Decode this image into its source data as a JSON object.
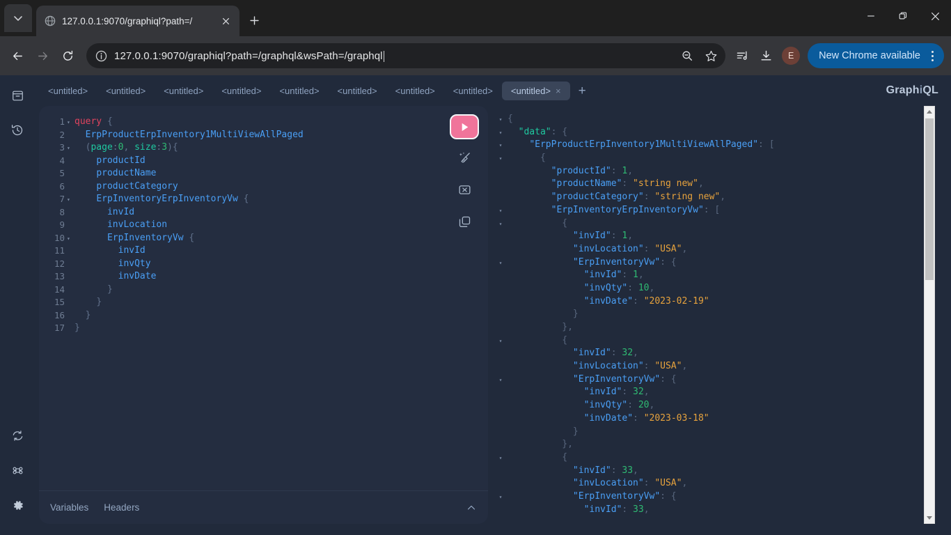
{
  "browser": {
    "tab": {
      "title": "127.0.0.1:9070/graphiql?path=/",
      "favicon_icon": "globe-icon",
      "close_icon": "close-icon"
    },
    "tab_search_icon": "chevron-down-icon",
    "new_tab_icon": "plus-icon",
    "window_controls": {
      "minimize": "minimize-icon",
      "maximize": "restore-icon",
      "close": "close-icon"
    },
    "nav": {
      "back_icon": "arrow-left-icon",
      "forward_icon": "arrow-right-icon",
      "reload_icon": "reload-icon"
    },
    "omnibox": {
      "url": "127.0.0.1:9070/graphiql?path=/graphql&wsPath=/graphql",
      "info_icon": "info-circle-icon",
      "zoom_icon": "search-minus-icon",
      "bookmark_icon": "star-icon"
    },
    "toolbar": {
      "media_icon": "media-playlist-icon",
      "downloads_icon": "download-icon",
      "profile_initial": "E",
      "update_label": "New Chrome available",
      "menu_icon": "kebab-menu-icon",
      "accent_color": "#0a5b9c"
    }
  },
  "graphiql": {
    "logo": {
      "prefix": "Graph",
      "middle": "i",
      "suffix": "QL"
    },
    "sidebar": [
      {
        "name": "docs-icon",
        "title": "Show Documentation Explorer"
      },
      {
        "name": "history-icon",
        "title": "Show History"
      },
      {
        "name": "refetch-icon",
        "title": "Re-fetch GraphQL schema"
      },
      {
        "name": "shortcuts-icon",
        "title": "Open short keys dialog"
      },
      {
        "name": "settings-icon",
        "title": "Open settings dialog"
      }
    ],
    "tabs": [
      {
        "label": "<untitled>",
        "active": false
      },
      {
        "label": "<untitled>",
        "active": false
      },
      {
        "label": "<untitled>",
        "active": false
      },
      {
        "label": "<untitled>",
        "active": false
      },
      {
        "label": "<untitled>",
        "active": false
      },
      {
        "label": "<untitled>",
        "active": false
      },
      {
        "label": "<untitled>",
        "active": false
      },
      {
        "label": "<untitled>",
        "active": false
      },
      {
        "label": "<untitled>",
        "active": true
      }
    ],
    "add_tab_label": "+",
    "close_tab_label": "×",
    "editor_tools": {
      "execute_icon": "play-icon",
      "execute_color": "#f0749a",
      "prettify_icon": "prettify-broom-icon",
      "merge_icon": "merge-icon",
      "copy_icon": "copy-icon"
    },
    "editor_footer": {
      "variables_label": "Variables",
      "headers_label": "Headers",
      "collapse_icon": "chevron-up-icon"
    },
    "query_lines": [
      {
        "n": "1",
        "fold": "▾",
        "tokens": [
          [
            "kw",
            "query"
          ],
          [
            "plain",
            " "
          ],
          [
            "punc",
            "{"
          ]
        ]
      },
      {
        "n": "2",
        "fold": "",
        "tokens": [
          [
            "plain",
            "  "
          ],
          [
            "field",
            "ErpProductErpInventory1MultiViewAllPaged"
          ]
        ]
      },
      {
        "n": "3",
        "fold": "▾",
        "tokens": [
          [
            "plain",
            "  "
          ],
          [
            "punc",
            "("
          ],
          [
            "arg",
            "page"
          ],
          [
            "punc",
            ":"
          ],
          [
            "num",
            "0"
          ],
          [
            "punc",
            ", "
          ],
          [
            "arg",
            "size"
          ],
          [
            "punc",
            ":"
          ],
          [
            "num",
            "3"
          ],
          [
            "punc",
            "){"
          ]
        ]
      },
      {
        "n": "4",
        "fold": "",
        "tokens": [
          [
            "plain",
            "    "
          ],
          [
            "field",
            "productId"
          ]
        ]
      },
      {
        "n": "5",
        "fold": "",
        "tokens": [
          [
            "plain",
            "    "
          ],
          [
            "field",
            "productName"
          ]
        ]
      },
      {
        "n": "6",
        "fold": "",
        "tokens": [
          [
            "plain",
            "    "
          ],
          [
            "field",
            "productCategory"
          ]
        ]
      },
      {
        "n": "7",
        "fold": "▾",
        "tokens": [
          [
            "plain",
            "    "
          ],
          [
            "field",
            "ErpInventoryErpInventoryVw"
          ],
          [
            "plain",
            " "
          ],
          [
            "punc",
            "{"
          ]
        ]
      },
      {
        "n": "8",
        "fold": "",
        "tokens": [
          [
            "plain",
            "      "
          ],
          [
            "field",
            "invId"
          ]
        ]
      },
      {
        "n": "9",
        "fold": "",
        "tokens": [
          [
            "plain",
            "      "
          ],
          [
            "field",
            "invLocation"
          ]
        ]
      },
      {
        "n": "10",
        "fold": "▾",
        "tokens": [
          [
            "plain",
            "      "
          ],
          [
            "field",
            "ErpInventoryVw"
          ],
          [
            "plain",
            " "
          ],
          [
            "punc",
            "{"
          ]
        ]
      },
      {
        "n": "11",
        "fold": "",
        "tokens": [
          [
            "plain",
            "        "
          ],
          [
            "field",
            "invId"
          ]
        ]
      },
      {
        "n": "12",
        "fold": "",
        "tokens": [
          [
            "plain",
            "        "
          ],
          [
            "field",
            "invQty"
          ]
        ]
      },
      {
        "n": "13",
        "fold": "",
        "tokens": [
          [
            "plain",
            "        "
          ],
          [
            "field",
            "invDate"
          ]
        ]
      },
      {
        "n": "14",
        "fold": "",
        "tokens": [
          [
            "plain",
            "      "
          ],
          [
            "punc",
            "}"
          ]
        ]
      },
      {
        "n": "15",
        "fold": "",
        "tokens": [
          [
            "plain",
            "    "
          ],
          [
            "punc",
            "}"
          ]
        ]
      },
      {
        "n": "16",
        "fold": "",
        "tokens": [
          [
            "plain",
            "  "
          ],
          [
            "punc",
            "}"
          ]
        ]
      },
      {
        "n": "17",
        "fold": "",
        "tokens": [
          [
            "plain",
            ""
          ],
          [
            "punc",
            "}"
          ]
        ]
      }
    ],
    "response_lines": [
      {
        "fold": "▾",
        "tokens": [
          [
            "punc",
            "{"
          ]
        ]
      },
      {
        "fold": "▾",
        "tokens": [
          [
            "plain",
            "  "
          ],
          [
            "keytop",
            "\"data\""
          ],
          [
            "punc",
            ": {"
          ]
        ]
      },
      {
        "fold": "▾",
        "tokens": [
          [
            "plain",
            "    "
          ],
          [
            "key",
            "\"ErpProductErpInventory1MultiViewAllPaged\""
          ],
          [
            "punc",
            ": ["
          ]
        ]
      },
      {
        "fold": "▾",
        "tokens": [
          [
            "plain",
            "      "
          ],
          [
            "punc",
            "{"
          ]
        ]
      },
      {
        "fold": "",
        "tokens": [
          [
            "plain",
            "        "
          ],
          [
            "key",
            "\"productId\""
          ],
          [
            "punc",
            ": "
          ],
          [
            "num",
            "1"
          ],
          [
            "punc",
            ","
          ]
        ]
      },
      {
        "fold": "",
        "tokens": [
          [
            "plain",
            "        "
          ],
          [
            "key",
            "\"productName\""
          ],
          [
            "punc",
            ": "
          ],
          [
            "str",
            "\"string new\""
          ],
          [
            "punc",
            ","
          ]
        ]
      },
      {
        "fold": "",
        "tokens": [
          [
            "plain",
            "        "
          ],
          [
            "key",
            "\"productCategory\""
          ],
          [
            "punc",
            ": "
          ],
          [
            "str",
            "\"string new\""
          ],
          [
            "punc",
            ","
          ]
        ]
      },
      {
        "fold": "▾",
        "tokens": [
          [
            "plain",
            "        "
          ],
          [
            "key",
            "\"ErpInventoryErpInventoryVw\""
          ],
          [
            "punc",
            ": ["
          ]
        ]
      },
      {
        "fold": "▾",
        "tokens": [
          [
            "plain",
            "          "
          ],
          [
            "punc",
            "{"
          ]
        ]
      },
      {
        "fold": "",
        "tokens": [
          [
            "plain",
            "            "
          ],
          [
            "key",
            "\"invId\""
          ],
          [
            "punc",
            ": "
          ],
          [
            "num",
            "1"
          ],
          [
            "punc",
            ","
          ]
        ]
      },
      {
        "fold": "",
        "tokens": [
          [
            "plain",
            "            "
          ],
          [
            "key",
            "\"invLocation\""
          ],
          [
            "punc",
            ": "
          ],
          [
            "str",
            "\"USA\""
          ],
          [
            "punc",
            ","
          ]
        ]
      },
      {
        "fold": "▾",
        "tokens": [
          [
            "plain",
            "            "
          ],
          [
            "key",
            "\"ErpInventoryVw\""
          ],
          [
            "punc",
            ": {"
          ]
        ]
      },
      {
        "fold": "",
        "tokens": [
          [
            "plain",
            "              "
          ],
          [
            "key",
            "\"invId\""
          ],
          [
            "punc",
            ": "
          ],
          [
            "num",
            "1"
          ],
          [
            "punc",
            ","
          ]
        ]
      },
      {
        "fold": "",
        "tokens": [
          [
            "plain",
            "              "
          ],
          [
            "key",
            "\"invQty\""
          ],
          [
            "punc",
            ": "
          ],
          [
            "num",
            "10"
          ],
          [
            "punc",
            ","
          ]
        ]
      },
      {
        "fold": "",
        "tokens": [
          [
            "plain",
            "              "
          ],
          [
            "key",
            "\"invDate\""
          ],
          [
            "punc",
            ": "
          ],
          [
            "str",
            "\"2023-02-19\""
          ]
        ]
      },
      {
        "fold": "",
        "tokens": [
          [
            "plain",
            "            "
          ],
          [
            "punc",
            "}"
          ]
        ]
      },
      {
        "fold": "",
        "tokens": [
          [
            "plain",
            "          "
          ],
          [
            "punc",
            "},"
          ]
        ]
      },
      {
        "fold": "▾",
        "tokens": [
          [
            "plain",
            "          "
          ],
          [
            "punc",
            "{"
          ]
        ]
      },
      {
        "fold": "",
        "tokens": [
          [
            "plain",
            "            "
          ],
          [
            "key",
            "\"invId\""
          ],
          [
            "punc",
            ": "
          ],
          [
            "num",
            "32"
          ],
          [
            "punc",
            ","
          ]
        ]
      },
      {
        "fold": "",
        "tokens": [
          [
            "plain",
            "            "
          ],
          [
            "key",
            "\"invLocation\""
          ],
          [
            "punc",
            ": "
          ],
          [
            "str",
            "\"USA\""
          ],
          [
            "punc",
            ","
          ]
        ]
      },
      {
        "fold": "▾",
        "tokens": [
          [
            "plain",
            "            "
          ],
          [
            "key",
            "\"ErpInventoryVw\""
          ],
          [
            "punc",
            ": {"
          ]
        ]
      },
      {
        "fold": "",
        "tokens": [
          [
            "plain",
            "              "
          ],
          [
            "key",
            "\"invId\""
          ],
          [
            "punc",
            ": "
          ],
          [
            "num",
            "32"
          ],
          [
            "punc",
            ","
          ]
        ]
      },
      {
        "fold": "",
        "tokens": [
          [
            "plain",
            "              "
          ],
          [
            "key",
            "\"invQty\""
          ],
          [
            "punc",
            ": "
          ],
          [
            "num",
            "20"
          ],
          [
            "punc",
            ","
          ]
        ]
      },
      {
        "fold": "",
        "tokens": [
          [
            "plain",
            "              "
          ],
          [
            "key",
            "\"invDate\""
          ],
          [
            "punc",
            ": "
          ],
          [
            "str",
            "\"2023-03-18\""
          ]
        ]
      },
      {
        "fold": "",
        "tokens": [
          [
            "plain",
            "            "
          ],
          [
            "punc",
            "}"
          ]
        ]
      },
      {
        "fold": "",
        "tokens": [
          [
            "plain",
            "          "
          ],
          [
            "punc",
            "},"
          ]
        ]
      },
      {
        "fold": "▾",
        "tokens": [
          [
            "plain",
            "          "
          ],
          [
            "punc",
            "{"
          ]
        ]
      },
      {
        "fold": "",
        "tokens": [
          [
            "plain",
            "            "
          ],
          [
            "key",
            "\"invId\""
          ],
          [
            "punc",
            ": "
          ],
          [
            "num",
            "33"
          ],
          [
            "punc",
            ","
          ]
        ]
      },
      {
        "fold": "",
        "tokens": [
          [
            "plain",
            "            "
          ],
          [
            "key",
            "\"invLocation\""
          ],
          [
            "punc",
            ": "
          ],
          [
            "str",
            "\"USA\""
          ],
          [
            "punc",
            ","
          ]
        ]
      },
      {
        "fold": "▾",
        "tokens": [
          [
            "plain",
            "            "
          ],
          [
            "key",
            "\"ErpInventoryVw\""
          ],
          [
            "punc",
            ": {"
          ]
        ]
      },
      {
        "fold": "",
        "tokens": [
          [
            "plain",
            "              "
          ],
          [
            "key",
            "\"invId\""
          ],
          [
            "punc",
            ": "
          ],
          [
            "num",
            "33"
          ],
          [
            "punc",
            ","
          ]
        ]
      }
    ]
  }
}
